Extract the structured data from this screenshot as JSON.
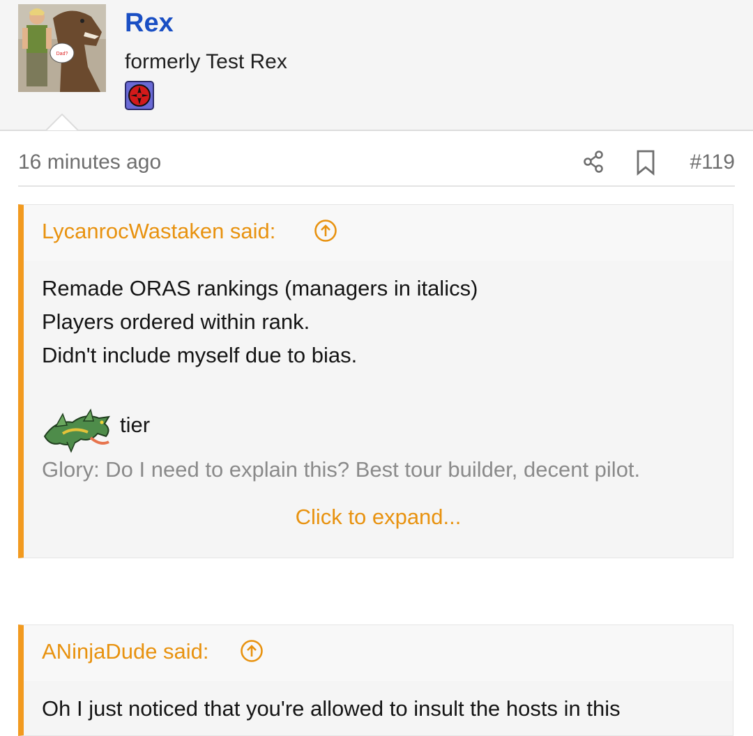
{
  "user": {
    "name": "Rex",
    "title": "formerly Test Rex",
    "avatar_caption": "Dad?"
  },
  "post": {
    "time": "16 minutes ago",
    "number": "#119"
  },
  "quotes": [
    {
      "author": "LycanrocWastaken said:",
      "lines": [
        "Remade ORAS rankings (managers in italics)",
        "Players ordered within rank.",
        "Didn't include myself due to bias."
      ],
      "tier_label": "tier",
      "faded_line": "Glory: Do I need to explain this? Best tour builder, decent pilot.",
      "expand_label": "Click to expand..."
    },
    {
      "author": "ANinjaDude said:",
      "lines": [
        "Oh I just noticed that you're allowed to insult the hosts in this"
      ]
    }
  ],
  "icons": {
    "share": "share-icon",
    "bookmark": "bookmark-icon",
    "quote_jump": "arrow-up-circle-icon",
    "badge": "team-badge-icon"
  },
  "colors": {
    "accent_orange": "#e8920f",
    "quote_border": "#f29a1f",
    "username_blue": "#1a4fc4"
  }
}
